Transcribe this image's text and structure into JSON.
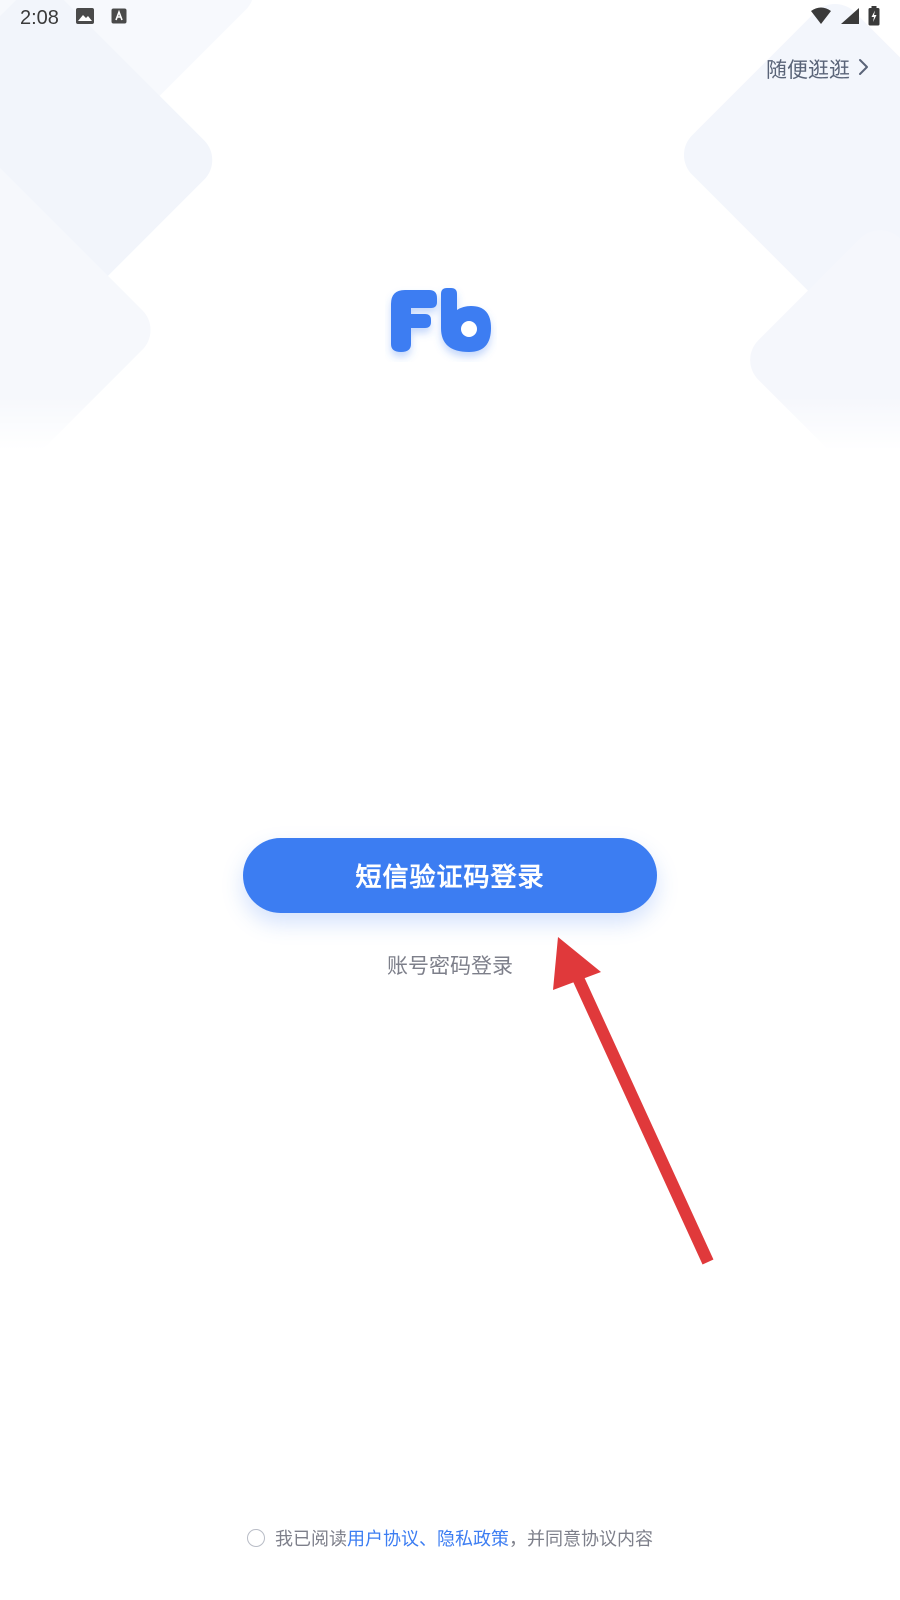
{
  "status_bar": {
    "time": "2:08",
    "left_icons": [
      "image-icon",
      "a-box-icon"
    ],
    "right_icons": [
      "wifi-icon",
      "signal-icon",
      "battery-charging-icon"
    ]
  },
  "header": {
    "browse_label": "随便逛逛",
    "browse_icon": "chevron-right-icon"
  },
  "logo": {
    "icon": "app-logo-icon",
    "color": "#3c7df2"
  },
  "login": {
    "sms_button_label": "短信验证码登录",
    "account_login_label": "账号密码登录"
  },
  "agreement": {
    "prefix": "我已阅读",
    "user_agreement": "用户协议",
    "separator": "、",
    "privacy_policy": "隐私政策",
    "suffix": "，并同意协议内容",
    "checked": false
  },
  "colors": {
    "primary": "#3c7df2",
    "annotation": "#e0393b",
    "muted_text": "#7d7f8a"
  }
}
